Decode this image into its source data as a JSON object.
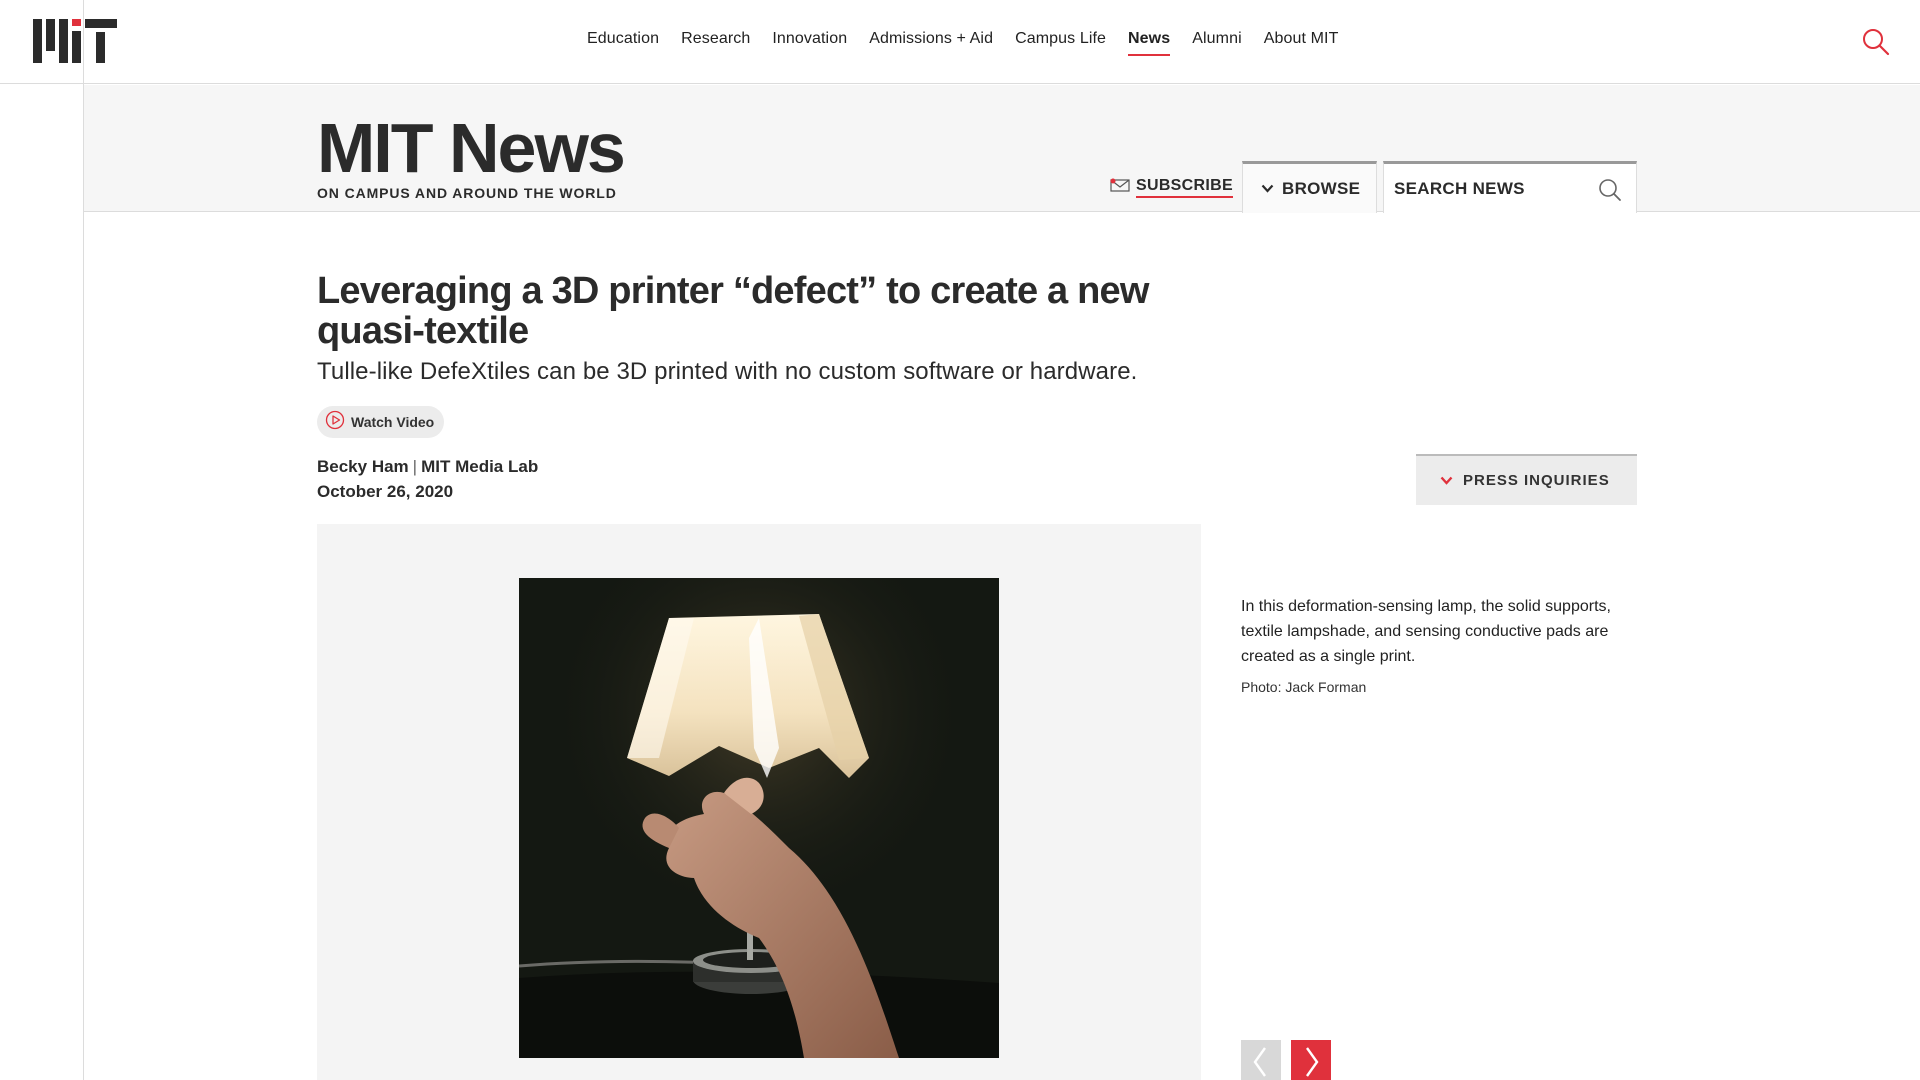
{
  "top_nav": {
    "logo_alt": "MIT",
    "links": [
      {
        "label": "Education"
      },
      {
        "label": "Research"
      },
      {
        "label": "Innovation"
      },
      {
        "label": "Admissions + Aid"
      },
      {
        "label": "Campus Life"
      },
      {
        "label": "News",
        "active": true
      },
      {
        "label": "Alumni"
      },
      {
        "label": "About MIT"
      }
    ],
    "search_icon": "search-icon"
  },
  "news_header": {
    "title": "MIT News",
    "tagline": "ON CAMPUS AND AROUND THE WORLD",
    "subscribe_label": "SUBSCRIBE",
    "browse_label": "BROWSE",
    "search_placeholder": "SEARCH NEWS"
  },
  "article": {
    "title": "Leveraging a 3D printer “defect” to create a new quasi-textile",
    "subtitle": "Tulle-like DefeXtiles can be 3D printed with no custom software or hardware.",
    "watch_video_label": "Watch Video",
    "author": "Becky Ham",
    "separator": "|",
    "affiliation": "MIT Media Lab",
    "date": "October 26, 2020",
    "press_inquiries_label": "PRESS INQUIRIES"
  },
  "figure": {
    "caption": "In this deformation-sensing lamp, the solid supports, textile lampshade, and sensing conductive pads are created as a single print.",
    "credit": "Photo: Jack Forman"
  },
  "colors": {
    "accent": "#e0313c",
    "text": "#2b2b2b",
    "band": "#f6f6f6"
  }
}
